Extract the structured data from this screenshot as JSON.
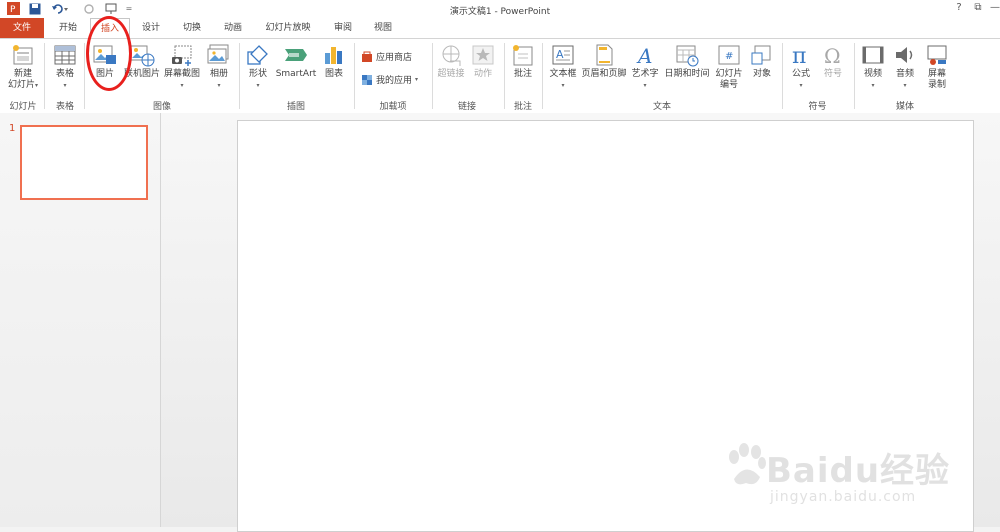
{
  "window": {
    "title": "演示文稿1 - PowerPoint",
    "help": "?",
    "restore": "⧉",
    "minimize": "—"
  },
  "qat": {
    "customize": "="
  },
  "tabs": [
    "文件",
    "开始",
    "插入",
    "设计",
    "切换",
    "动画",
    "幻灯片放映",
    "审阅",
    "视图"
  ],
  "ribbon": {
    "new_slide": "新建\n幻灯片",
    "table": "表格",
    "picture": "图片",
    "online_picture": "联机图片",
    "screenshot": "屏幕截图",
    "album": "相册",
    "shapes": "形状",
    "smartart": "SmartArt",
    "chart": "图表",
    "store": "应用商店",
    "my_apps": "我的应用",
    "hyperlink": "超链接",
    "action": "动作",
    "comment": "批注",
    "textbox": "文本框",
    "header_footer": "页眉和页脚",
    "wordart": "艺术字",
    "datetime": "日期和时间",
    "slide_number_1": "幻灯片",
    "slide_number_2": "编号",
    "object": "对象",
    "equation": "公式",
    "symbol": "符号",
    "video": "视频",
    "audio": "音频",
    "screen_record_1": "屏幕",
    "screen_record_2": "录制",
    "groups": {
      "slides": "幻灯片",
      "tables": "表格",
      "images": "图像",
      "illustrations": "插图",
      "addins": "加载项",
      "links": "链接",
      "comments": "批注",
      "text": "文本",
      "symbols": "符号",
      "media": "媒体"
    }
  },
  "thumbnail": {
    "number": "1"
  },
  "watermark": {
    "brand": "Baidu经验",
    "url": "jingyan.baidu.com"
  },
  "colors": {
    "accent": "#d24726",
    "annotation": "#e8201d"
  }
}
